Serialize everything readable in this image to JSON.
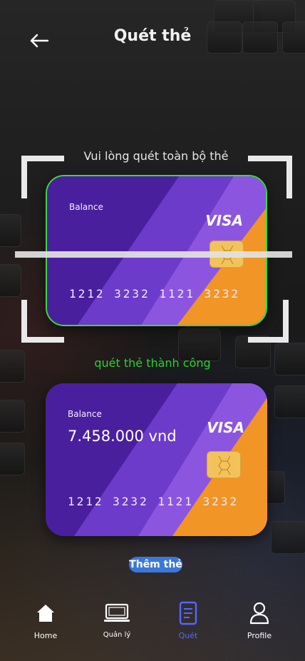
{
  "header": {
    "title": "Quét thẻ",
    "back_icon": "arrow-left-icon"
  },
  "scanner": {
    "hint": "Vui lòng quét toàn bộ thẻ",
    "success_message": "quét thẻ thành công",
    "frame_color": "#e9e9e9",
    "success_color": "#2fd12f"
  },
  "scanned_card": {
    "label": "Balance",
    "brand": "VISA",
    "number": "1212 3232  1121 3232"
  },
  "result_card": {
    "label": "Balance",
    "amount": "7.458.000 vnd",
    "brand": "VISA",
    "number": "1212 3232  1121 3232"
  },
  "add_button": {
    "label": "Thêm thẻ"
  },
  "card_colors": {
    "deep": "#4a1f9e",
    "mid": "#6c3bc9",
    "light": "#8c55e0",
    "accent": "#f19526"
  },
  "tabs": [
    {
      "label": "Home",
      "icon": "home-icon",
      "active": false
    },
    {
      "label": "Quản lý",
      "icon": "laptop-icon",
      "active": false
    },
    {
      "label": "Quét",
      "icon": "document-icon",
      "active": true
    },
    {
      "label": "Profile",
      "icon": "user-icon",
      "active": false
    }
  ],
  "accent_color": "#5567ff"
}
